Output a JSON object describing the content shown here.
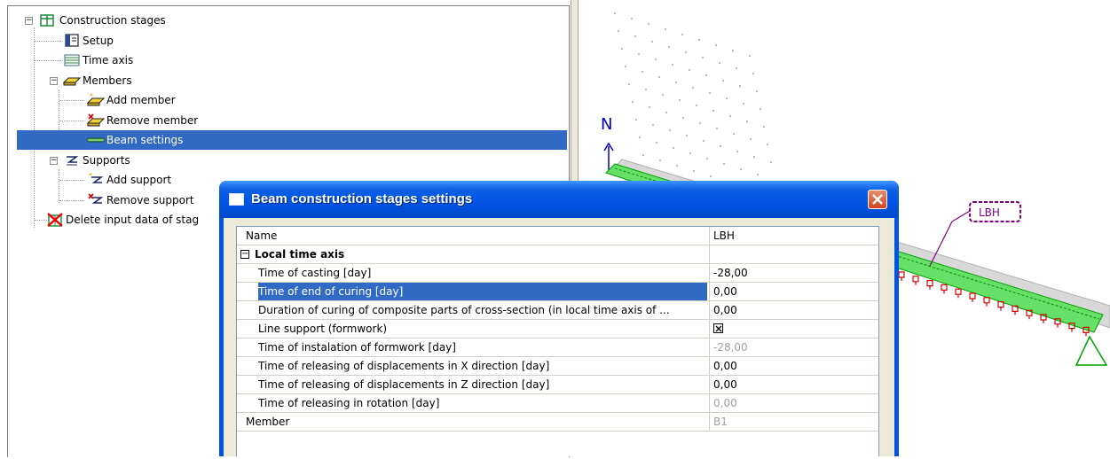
{
  "tree": {
    "items": [
      {
        "label": "Construction stages",
        "icon": "construction-stages-icon",
        "expander": "−"
      },
      {
        "label": "Setup",
        "icon": "setup-icon"
      },
      {
        "label": "Time axis",
        "icon": "time-axis-icon"
      },
      {
        "label": "Members",
        "icon": "members-icon",
        "expander": "−"
      },
      {
        "label": "Add member",
        "icon": "add-member-icon"
      },
      {
        "label": "Remove member",
        "icon": "remove-member-icon"
      },
      {
        "label": "Beam settings",
        "icon": "beam-settings-icon",
        "selected": true
      },
      {
        "label": "Supports",
        "icon": "supports-icon",
        "expander": "−"
      },
      {
        "label": "Add support",
        "icon": "add-support-icon"
      },
      {
        "label": "Remove support",
        "icon": "remove-support-icon"
      },
      {
        "label": "Delete input data of stag",
        "icon": "delete-input-data-icon"
      }
    ]
  },
  "view": {
    "axis_label": "N",
    "member_label": "LBH",
    "colors": {
      "axis": "#0000cc",
      "beam": "#00c000",
      "supports": "#d00000",
      "label": "#800080"
    }
  },
  "dialog": {
    "title": "Beam construction stages settings",
    "rows": [
      {
        "name": "Name",
        "value": "LBH"
      },
      {
        "name": "Local time axis",
        "value": "",
        "category": true,
        "expander": "−"
      },
      {
        "name": "Time of casting [day]",
        "value": "-28,00"
      },
      {
        "name": "Time of end of curing [day]",
        "value": "0,00",
        "selected": true
      },
      {
        "name": "Duration of curing of composite parts of cross-section (in local time axis of ...",
        "value": "0,00"
      },
      {
        "name": "Line support (formwork)",
        "value": "",
        "checkbox": true,
        "checked": true
      },
      {
        "name": "Time of instalation of formwork [day]",
        "value": "-28,00",
        "disabled": true
      },
      {
        "name": "Time of releasing of displacements in X direction [day]",
        "value": "0,00"
      },
      {
        "name": "Time of releasing of displacements in Z direction [day]",
        "value": "0,00"
      },
      {
        "name": "Time of releasing in rotation [day]",
        "value": "0,00",
        "disabled": true
      },
      {
        "name": "Member",
        "value": "B1",
        "disabled": true
      }
    ]
  }
}
